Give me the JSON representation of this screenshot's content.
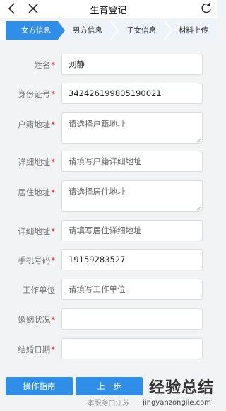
{
  "header": {
    "title": "生育登记"
  },
  "steps": [
    {
      "label": "女方信息",
      "active": true
    },
    {
      "label": "男方信息",
      "active": false
    },
    {
      "label": "子女信息",
      "active": false
    },
    {
      "label": "材料上传",
      "active": false
    }
  ],
  "form": {
    "name": {
      "label": "姓名",
      "value": "刘静"
    },
    "id_number": {
      "label": "身份证号",
      "value": "342426199805190021"
    },
    "household_address": {
      "label": "户籍地址",
      "placeholder": "请选择户籍地址"
    },
    "household_detail": {
      "label": "详细地址",
      "placeholder": "请填写户籍详细地址"
    },
    "residence_address": {
      "label": "居住地址",
      "placeholder": "请选择居住地址"
    },
    "residence_detail": {
      "label": "详细地址",
      "placeholder": "请填写居住详细地址"
    },
    "phone": {
      "label": "手机号码",
      "value": "19159283527"
    },
    "work_unit": {
      "label": "工作单位",
      "placeholder": "请填写工作单位"
    },
    "marital_status": {
      "label": "婚姻状况",
      "value": ""
    },
    "marriage_date": {
      "label": "结婚日期",
      "value": ""
    },
    "required_mark": "*"
  },
  "buttons": {
    "guide": "操作指南",
    "prev": "上一步"
  },
  "footer": {
    "text": "本服务由江苏"
  },
  "watermark": {
    "title": "经验总结",
    "url": "jingyanzongjie.com"
  },
  "colors": {
    "active_step": "#2f8fe8",
    "inactive_step": "#eef3f9",
    "required": "#d0211c",
    "button": "#2f8fe8"
  }
}
